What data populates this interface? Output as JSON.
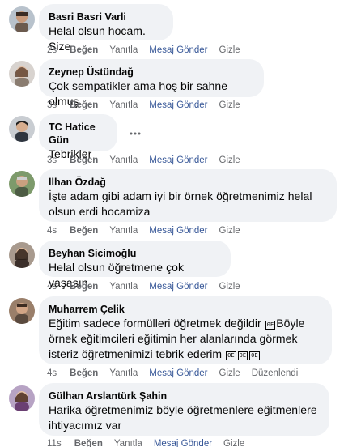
{
  "comments": [
    {
      "author": "Basri Basri Varli",
      "text": "Helal olsun hocam. Size",
      "time": "2s",
      "like": "Beğen",
      "reply": "Yanıtla",
      "message": "Mesaj Gönder",
      "hide": "Gizle"
    },
    {
      "author": "Zeynep Üstündağ",
      "text": "Çok sempatikler ama hoş bir sahne olmuş",
      "time": "3s",
      "like": "Beğen",
      "reply": "Yanıtla",
      "message": "Mesaj Gönder",
      "hide": "Gizle"
    },
    {
      "author": "TC Hatice Gün",
      "text": "Tebrikler",
      "time": "3s",
      "like": "Beğen",
      "reply": "Yanıtla",
      "message": "Mesaj Gönder",
      "hide": "Gizle"
    },
    {
      "author": "İlhan Özdağ",
      "text_line1": "İşte adam gibi adam iyi bir örnek öğretmenimiz helal",
      "text_line2": "olsun erdi hocamiza",
      "time": "4s",
      "like": "Beğen",
      "reply": "Yanıtla",
      "message": "Mesaj Gönder",
      "hide": "Gizle"
    },
    {
      "author": "Beyhan Sicimoğlu",
      "text": "Helal olsun öğretmene çok yaşasın",
      "time": "4s",
      "like": "Beğen",
      "reply": "Yanıtla",
      "message": "Mesaj Gönder",
      "hide": "Gizle"
    },
    {
      "author": "Muharrem Çelik",
      "text_line1": "Eğitim sadece formülleri öğretmek değildir",
      "text_line1b": "Böyle",
      "text_line2": "örnek eğitimcileri eğitimin her alanlarında görmek",
      "text_line3": "isteriz öğretmenimizi tebrik ederim",
      "glyph": "0E",
      "time": "4s",
      "like": "Beğen",
      "reply": "Yanıtla",
      "message": "Mesaj Gönder",
      "hide": "Gizle",
      "edited": "Düzenlendi"
    },
    {
      "author": "Gülhan Arslantürk Şahin",
      "text_line1": "Harika öğretmenimiz böyle öğretmenlere eğitmenlere",
      "text_line2": "ihtiyacımız var",
      "time": "11s",
      "like": "Beğen",
      "reply": "Yanıtla",
      "message": "Mesaj Gönder",
      "hide": "Gizle"
    }
  ],
  "colors": {
    "bubble": "#f0f2f5",
    "meta": "#65676b",
    "link": "#385898",
    "text": "#050505"
  },
  "icons": {
    "more": "more-horizontal-icon"
  }
}
